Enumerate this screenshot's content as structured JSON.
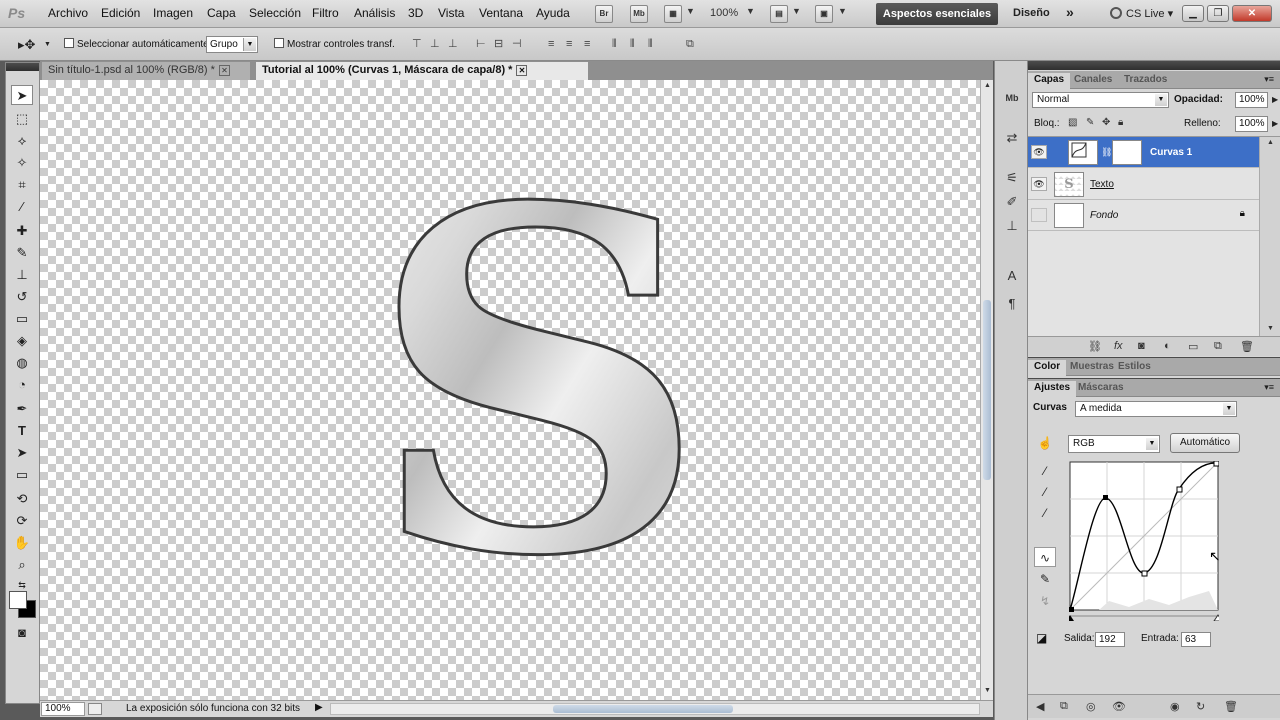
{
  "app": {
    "logo": "Ps",
    "menu": [
      "Archivo",
      "Edición",
      "Imagen",
      "Capa",
      "Selección",
      "Filtro",
      "Análisis",
      "3D",
      "Vista",
      "Ventana",
      "Ayuda"
    ],
    "bridge_label": "Br",
    "minibridge_label": "Mb",
    "zoom": "100%",
    "workspace_active": "Aspectos esenciales",
    "workspace_design": "Diseño",
    "workspace_more": "»",
    "cslive": "CS Live",
    "win_min": "▁",
    "win_max": "❐",
    "win_close": "✕"
  },
  "options": {
    "auto_select": "Seleccionar automáticamente:",
    "auto_select_value": "Grupo",
    "show_transform": "Mostrar controles transf."
  },
  "document": {
    "tabs": [
      {
        "title": "Sin título-1.psd al 100% (RGB/8) *",
        "close": "✕"
      },
      {
        "title": "Tutorial al 100% (Curvas 1, Máscara de capa/8) *",
        "close": "✕"
      }
    ],
    "letter": "S"
  },
  "status": {
    "zoom": "100%",
    "message": "La exposición sólo funciona con 32 bits",
    "arrow": "▶"
  },
  "layers_panel": {
    "tabs": [
      "Capas",
      "Canales",
      "Trazados"
    ],
    "blend_mode": "Normal",
    "opacity_label": "Opacidad:",
    "opacity": "100%",
    "lock_label": "Bloq.:",
    "fill_label": "Relleno:",
    "fill": "100%",
    "layers": [
      {
        "name": "Curvas 1",
        "visible": true,
        "selected": true
      },
      {
        "name": "Texto",
        "visible": true,
        "selected": false
      },
      {
        "name": "Fondo",
        "visible": false,
        "selected": false,
        "locked": true
      }
    ]
  },
  "color_panel": {
    "tabs": [
      "Color",
      "Muestras",
      "Estilos"
    ]
  },
  "adjustments_panel": {
    "tabs": [
      "Ajustes",
      "Máscaras"
    ],
    "curves_label": "Curvas",
    "preset": "A medida",
    "channel": "RGB",
    "auto_button": "Automático",
    "output_label": "Salida:",
    "output": "192",
    "input_label": "Entrada:",
    "input": "63"
  },
  "colors": {
    "selected_layer": "#3d6fc7",
    "workspace_button": "#3c3c3c"
  }
}
